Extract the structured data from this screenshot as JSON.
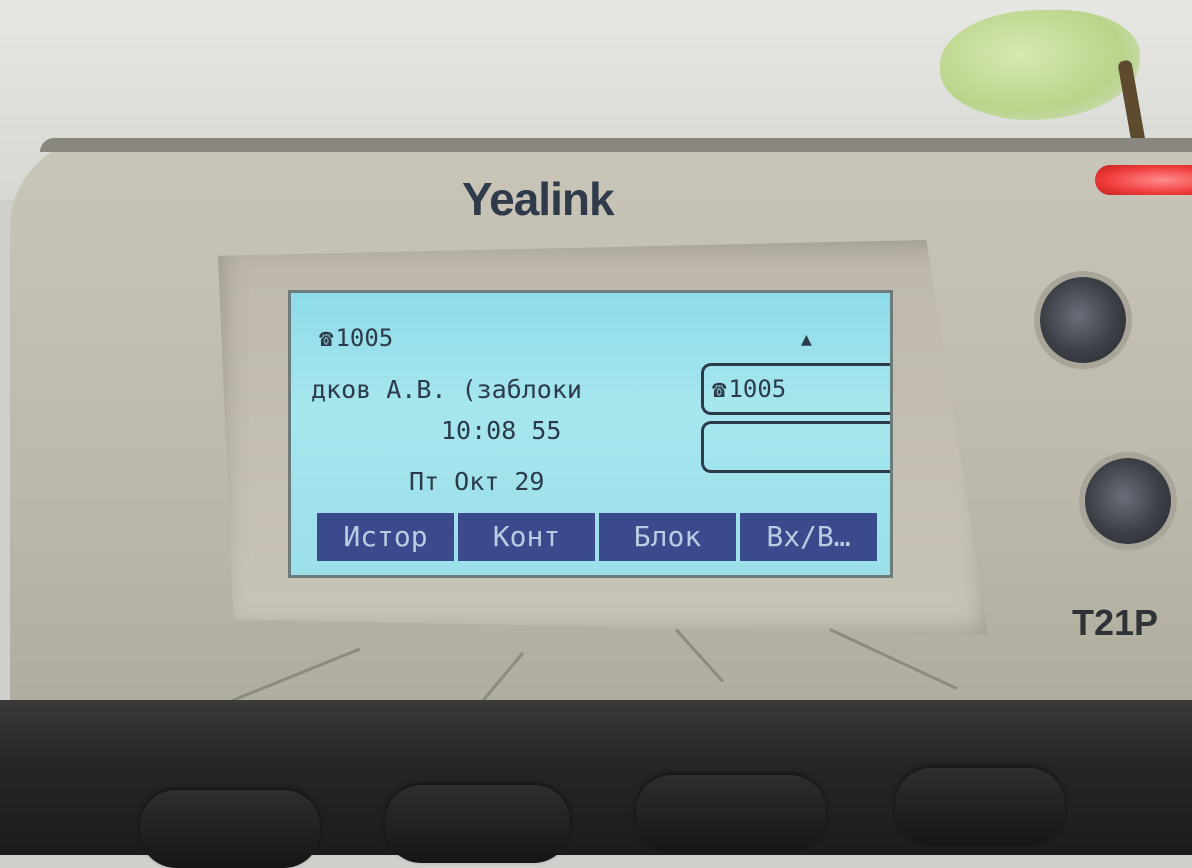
{
  "phone": {
    "brand": "Yealink",
    "model": "T21P"
  },
  "screen": {
    "account_icon": "phone-icon",
    "account": "1005",
    "caller": "дков А.В. (заблоки",
    "time": "10:08 55",
    "date": "Пт Окт 29",
    "line_key": {
      "icon": "phone-icon",
      "label": "1005"
    },
    "warning_icon": "warning-icon"
  },
  "softkeys": [
    {
      "label": "Истор"
    },
    {
      "label": "Конт"
    },
    {
      "label": "Блок"
    },
    {
      "label": "Вх/В…"
    }
  ],
  "colors": {
    "lcd": "#9bdfe9",
    "softkey_bg": "#3a4a8c",
    "softkey_text": "#b8cce2",
    "led": "#f03c3c"
  }
}
